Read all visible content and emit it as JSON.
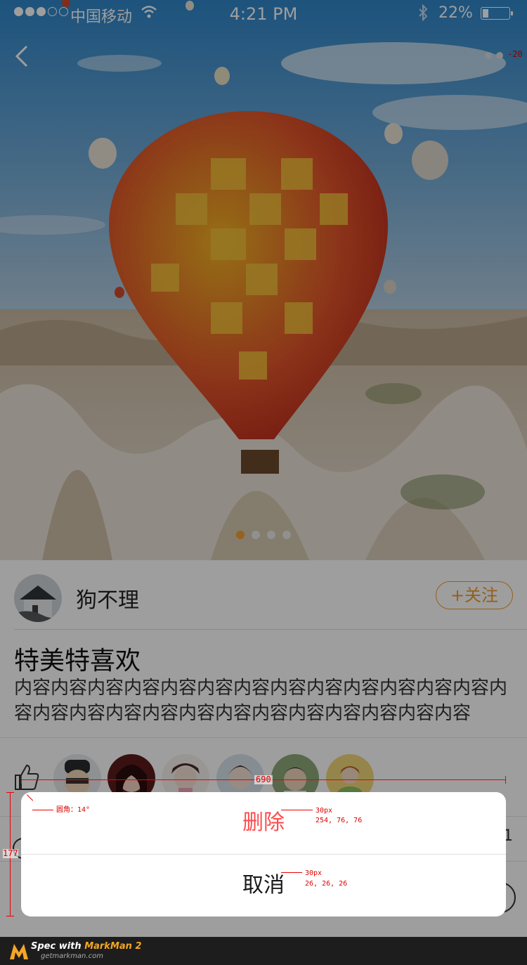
{
  "status_bar": {
    "carrier": "中国移动",
    "time": "4:21 PM",
    "battery": "22%"
  },
  "header": {
    "more_badge": "-20"
  },
  "carousel": {
    "page_count": 4,
    "active_page": 1
  },
  "post": {
    "author": "狗不理",
    "follow_label": "+关注",
    "title": "特美特喜欢",
    "body": "内容内容内容内容内容内容内容内容内容内容内容内容内容内容内容内容内容内容内容内容内容内容内容内容内容内容"
  },
  "comments": {
    "count_fragment": "21"
  },
  "action_sheet": {
    "delete_label": "删除",
    "cancel_label": "取消"
  },
  "annotations": {
    "width": "690",
    "height": "177",
    "corner": "圆角：14°",
    "delete_size": "30px",
    "delete_color": "254, 76, 76",
    "cancel_size": "30px",
    "cancel_color": "26, 26, 26"
  },
  "footer": {
    "brand_prefix": "Spec with ",
    "brand": "MarkMan 2",
    "url": "getmarkman.com"
  },
  "colors": {
    "accent": "#f09a2a",
    "delete": "#fe4c4c",
    "text": "#1a1a1a"
  }
}
